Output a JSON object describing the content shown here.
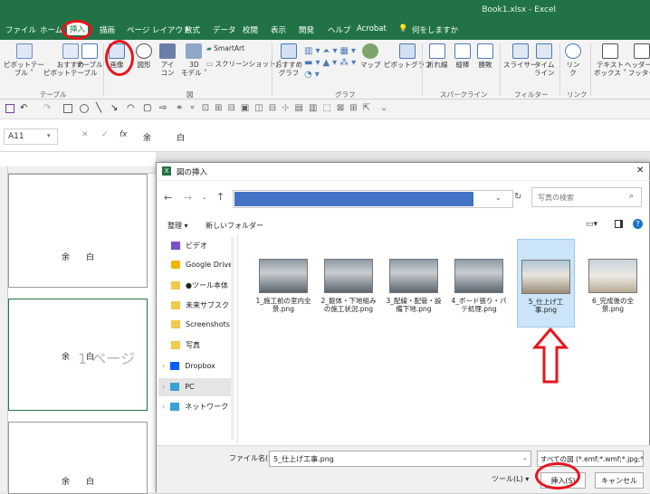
{
  "title": "Book1.xlsx  -  Excel",
  "menu": [
    "ファイル",
    "ホーム",
    "挿入",
    "描画",
    "ページ レイアウト",
    "数式",
    "データ",
    "校閲",
    "表示",
    "開発",
    "ヘルプ",
    "Acrobat",
    "何をしますか"
  ],
  "active_menu": "挿入",
  "ribbon": {
    "pivot": "ピボットテー\nブル ˅",
    "rec_pivot": "おすすめ\nピボットテーブル",
    "table": "テーブル",
    "table_group": "テーブル",
    "image": "画像",
    "shapes": "図形",
    "icons": "アイ\nコン",
    "model3d": "3D\nモデル ˅",
    "smartart": "SmartArt",
    "screenshot": "スクリーンショット ˅",
    "zu_group": "図",
    "rec_chart": "おすすめ\nグラフ",
    "map": "マップ",
    "pivot_chart": "ピボットグラフ",
    "chart_group": "グラフ",
    "line": "折れ線",
    "column": "縦棒",
    "winloss": "勝敗",
    "sparkline_group": "スパークライン",
    "slicer": "スライサー",
    "timeline": "タイム\nライン",
    "filter_group": "フィルター",
    "link": "リン\nク",
    "link_group": "リンク",
    "textbox": "テキスト\nボックス ˅",
    "header": "ヘッダーと\nフッター"
  },
  "namebox": "A11",
  "formula": "余白",
  "sheet": {
    "cell_text": "余白",
    "page_watermark": "1 ページ"
  },
  "dialog": {
    "title": "図の挿入",
    "search_placeholder": "写真の検索",
    "organize": "整理 ▾",
    "new_folder": "新しいフォルダー",
    "nav": [
      "ビデオ",
      "Google Drive",
      "●ツール本体",
      "未来サブスク",
      "Screenshots",
      "写真",
      "Dropbox",
      "PC",
      "ネットワーク"
    ],
    "files": [
      "1_施工前の室内全景.png",
      "2_躯体・下地組みの施工状況.png",
      "3_配線・配管・設備下地.png",
      "4_ボード張り・パテ処理.png",
      "5_仕上げ工事.png",
      "6_完成後の全景.png"
    ],
    "selected_index": 4,
    "filename_label": "ファイル名(N):",
    "filename_value": "5_仕上げ工事.png",
    "filetype": "すべての図 (*.emf;*.wmf;*.jpg;*.j",
    "tools": "ツール(L)  ▾",
    "insert_btn": "挿入(S)",
    "cancel_btn": "キャンセル"
  },
  "colors": {
    "excel_green": "#217346",
    "highlight": "#e8141c",
    "address_bar": "#4472c4",
    "selection": "#cce4f7"
  }
}
